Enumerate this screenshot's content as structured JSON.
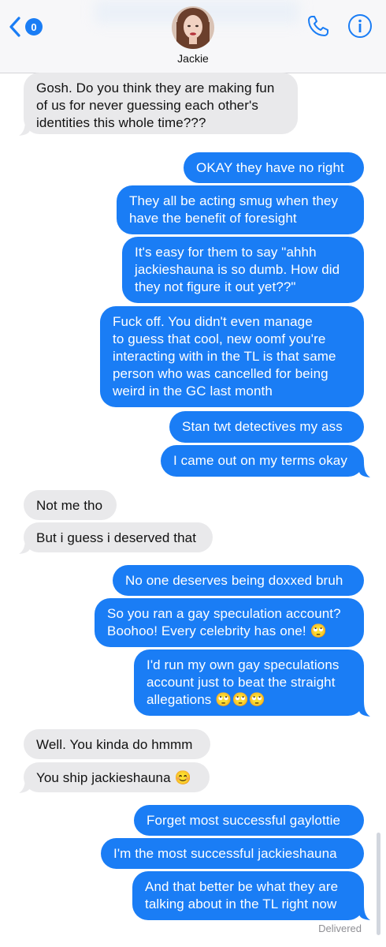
{
  "header": {
    "back_badge": "0",
    "contact_name": "Jackie"
  },
  "colors": {
    "outgoing": "#1a7df5",
    "incoming": "#e9e9eb",
    "accent": "#1a7df5"
  },
  "icons": {
    "back": "chevron-left-icon",
    "phone": "phone-icon",
    "info": "info-icon"
  },
  "messages": [
    {
      "direction": "in",
      "text": "Gosh. Do you think they are making fun\nof us for never guessing each other's\nidentities this whole time???"
    },
    {
      "direction": "out",
      "text": "OKAY they have no right"
    },
    {
      "direction": "out",
      "text": "They all be acting smug when they\nhave the benefit of foresight"
    },
    {
      "direction": "out",
      "text": "It's easy for them to say \"ahhh\njackieshauna is so dumb. How did\nthey not figure it out yet??\""
    },
    {
      "direction": "out",
      "text": "Fuck off. You didn't even manage\nto guess that cool, new oomf you're\ninteracting with in the TL is that same\nperson who was cancelled for being\nweird in the GC last month"
    },
    {
      "direction": "out",
      "text": "Stan twt detectives my ass"
    },
    {
      "direction": "out",
      "text": "I came out on my terms okay"
    },
    {
      "direction": "in",
      "text": "Not me tho"
    },
    {
      "direction": "in",
      "text": "But i guess i deserved that"
    },
    {
      "direction": "out",
      "text": "No one deserves being doxxed bruh"
    },
    {
      "direction": "out",
      "text": "So you ran a gay speculation account?\nBoohoo! Every celebrity has one! 🙄"
    },
    {
      "direction": "out",
      "text": "I'd run my own gay speculations\naccount just to beat the straight\nallegations 🙄🙄🙄"
    },
    {
      "direction": "in",
      "text": "Well. You kinda do hmmm"
    },
    {
      "direction": "in",
      "text": "You ship jackieshauna 😊"
    },
    {
      "direction": "out",
      "text": "Forget most successful gaylottie"
    },
    {
      "direction": "out",
      "text": "I'm the most successful jackieshauna"
    },
    {
      "direction": "out",
      "text": "And that better be what they are\ntalking about in the TL right now"
    }
  ],
  "status": {
    "delivered": "Delivered"
  }
}
